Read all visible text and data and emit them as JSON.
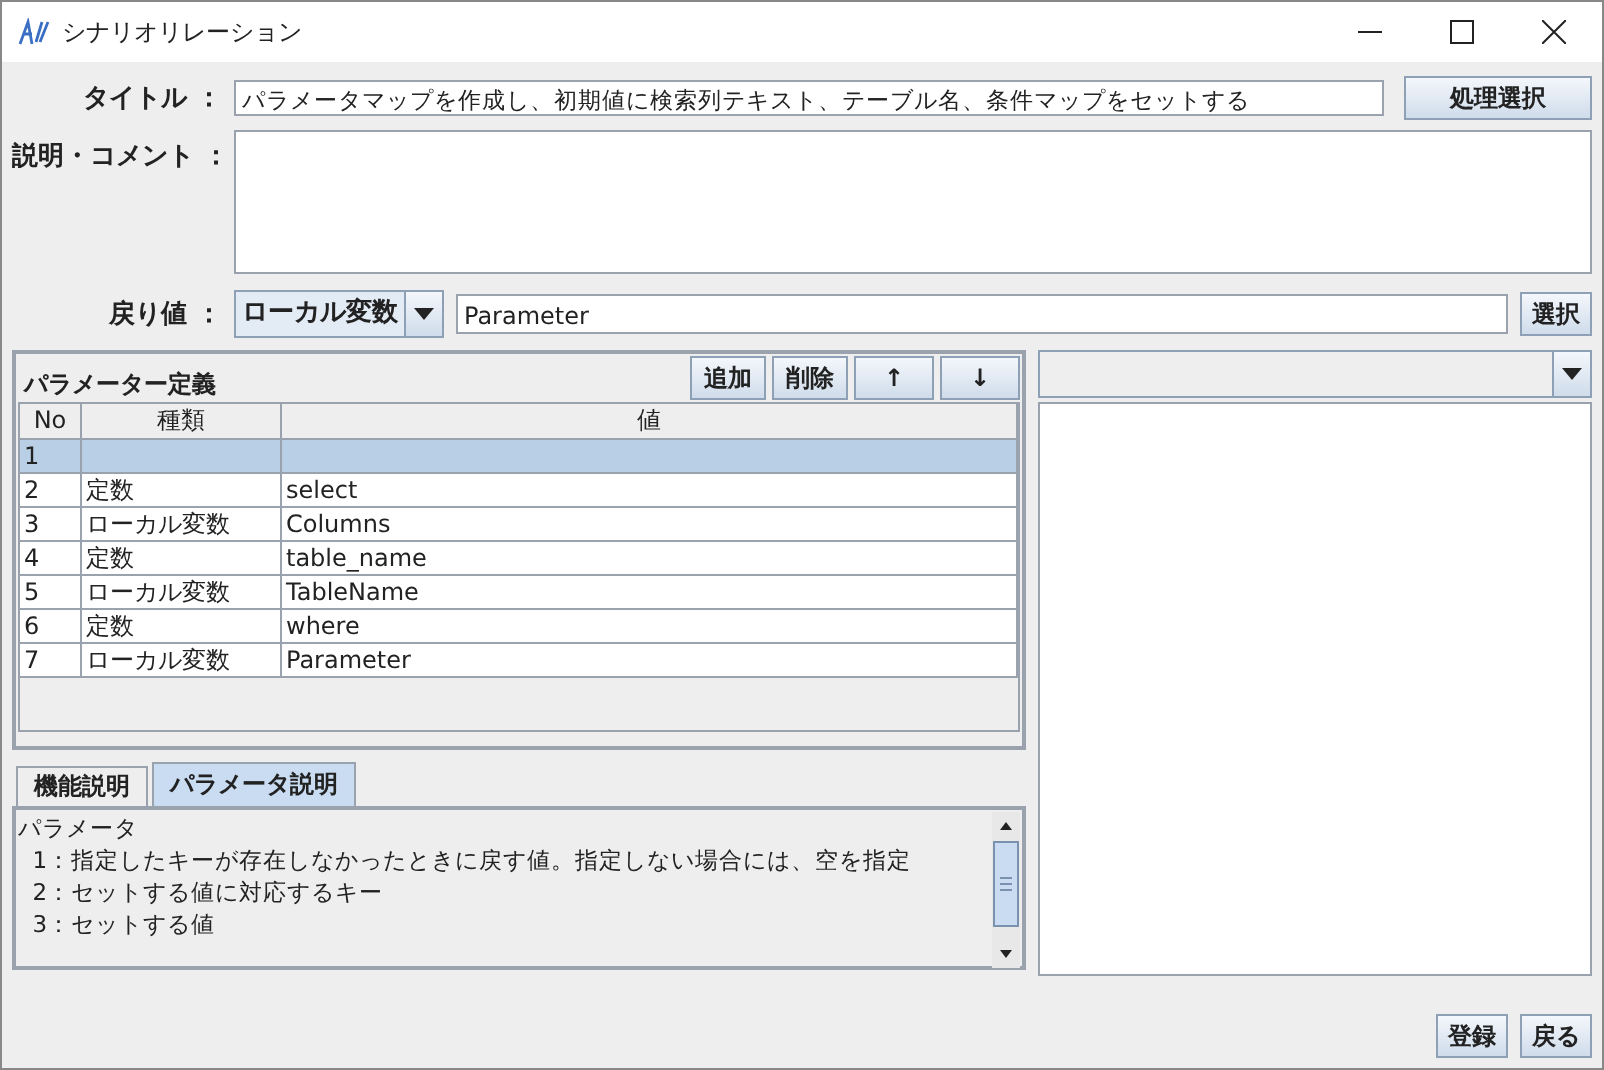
{
  "window": {
    "title": "シナリオリレーション"
  },
  "form": {
    "title_label": "タイトル ：",
    "title_value": "パラメータマップを作成し、初期値に検索列テキスト、テーブル名、条件マップをセットする",
    "select_process_button": "処理選択",
    "comment_label": "説明・コメント ：",
    "return_label": "戻り値 ：",
    "return_type": "ローカル変数",
    "return_value": "Parameter",
    "select_button": "選択"
  },
  "parameters": {
    "title": "パラメーター定義",
    "buttons": [
      {
        "label": "追加"
      },
      {
        "label": "削除"
      },
      {
        "label": "↑"
      },
      {
        "label": "↓"
      }
    ],
    "columns": [
      "No",
      "種類",
      "値"
    ],
    "rows": [
      {
        "no": "1",
        "type": "",
        "value": "",
        "selected": true
      },
      {
        "no": "2",
        "type": "定数",
        "value": "select",
        "selected": false
      },
      {
        "no": "3",
        "type": "ローカル変数",
        "value": "Columns",
        "selected": false
      },
      {
        "no": "4",
        "type": "定数",
        "value": "table_name",
        "selected": false
      },
      {
        "no": "5",
        "type": "ローカル変数",
        "value": "TableName",
        "selected": false
      },
      {
        "no": "6",
        "type": "定数",
        "value": "where",
        "selected": false
      },
      {
        "no": "7",
        "type": "ローカル変数",
        "value": "Parameter",
        "selected": false
      }
    ]
  },
  "help_tabs": [
    {
      "label": "機能説明",
      "selected": false
    },
    {
      "label": "パラメータ説明",
      "selected": true
    }
  ],
  "help_lines": [
    "パラメータ",
    "  1：指定したキーが存在しなかったときに戻す値。指定しない場合には、空を指定",
    "  2：セットする値に対応するキー",
    "  3：セットする値"
  ],
  "footer_buttons": [
    {
      "label": "登録"
    },
    {
      "label": "戻る"
    }
  ]
}
